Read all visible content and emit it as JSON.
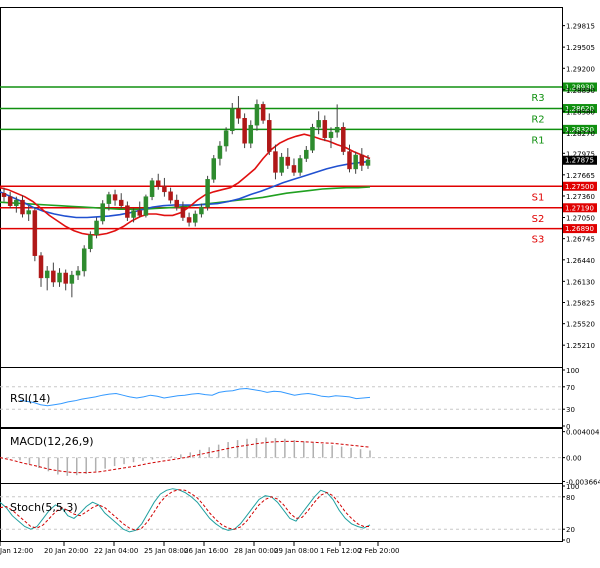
{
  "colors": {
    "background": "#ffffff",
    "axis": "#000000",
    "grid": "#c8c8c8",
    "bull_candle": "#2e8b2e",
    "bear_candle": "#b01818",
    "wick": "#404040",
    "ma_fast": "#e01010",
    "ma_mid": "#2050d0",
    "ma_slow": "#20a020",
    "resistance": "#109010",
    "support": "#e00000",
    "price_tag": "#000000",
    "rsi_line": "#3399ff",
    "macd_hist": "#b0b0b0",
    "macd_signal": "#d00000",
    "stoch_main": "#20a0a0",
    "stoch_signal": "#d00000"
  },
  "chart_data": [
    {
      "panel": "price",
      "type": "candlestick",
      "x": [
        "",
        "20 Jan 20:00",
        "22 Jan 04:00",
        "25 Jan 08:00",
        "26 Jan 16:00",
        "28 Jan 00:00",
        "29 Jan 08:00",
        "1 Feb 12:00",
        "2 Feb 20:00"
      ],
      "x_first_label_partial": "Jan 12:00",
      "y_ticks": [
        "1.29815",
        "1.29505",
        "1.29200",
        "1.28890",
        "1.28580",
        "1.28270",
        "1.27975",
        "1.27665",
        "1.27360",
        "1.27050",
        "1.26745",
        "1.26440",
        "1.26130",
        "1.25825",
        "1.25520",
        "1.25210"
      ],
      "ylim": [
        1.2491,
        1.3004
      ],
      "current_price": "1.27875",
      "levels": [
        {
          "label": "R3",
          "value": 1.2893,
          "tag": "1.28930",
          "kind": "resistance"
        },
        {
          "label": "R2",
          "value": 1.2862,
          "tag": "1.28620",
          "kind": "resistance"
        },
        {
          "label": "R1",
          "value": 1.2832,
          "tag": "1.28320",
          "kind": "resistance"
        },
        {
          "label": "S1",
          "value": 1.275,
          "tag": "1.27500",
          "kind": "support"
        },
        {
          "label": "S2",
          "value": 1.2719,
          "tag": "1.27190",
          "kind": "support"
        },
        {
          "label": "S3",
          "value": 1.2689,
          "tag": "1.26890",
          "kind": "support"
        }
      ],
      "candles": [
        [
          1.274,
          1.2748,
          1.2728,
          1.2735
        ],
        [
          1.2735,
          1.2742,
          1.2718,
          1.2722
        ],
        [
          1.2722,
          1.2735,
          1.2712,
          1.273
        ],
        [
          1.273,
          1.2737,
          1.2705,
          1.271
        ],
        [
          1.271,
          1.2722,
          1.27,
          1.2715
        ],
        [
          1.2715,
          1.272,
          1.2642,
          1.265
        ],
        [
          1.265,
          1.2655,
          1.2605,
          1.2618
        ],
        [
          1.2618,
          1.2635,
          1.26,
          1.2628
        ],
        [
          1.2628,
          1.264,
          1.2605,
          1.2612
        ],
        [
          1.2612,
          1.2632,
          1.2605,
          1.2625
        ],
        [
          1.2625,
          1.263,
          1.26,
          1.261
        ],
        [
          1.261,
          1.2628,
          1.259,
          1.2622
        ],
        [
          1.2622,
          1.2635,
          1.2615,
          1.2628
        ],
        [
          1.2628,
          1.2665,
          1.262,
          1.266
        ],
        [
          1.266,
          1.2685,
          1.2655,
          1.268
        ],
        [
          1.268,
          1.2705,
          1.2675,
          1.27
        ],
        [
          1.27,
          1.273,
          1.2695,
          1.2725
        ],
        [
          1.2725,
          1.2742,
          1.2715,
          1.2738
        ],
        [
          1.2738,
          1.2745,
          1.2722,
          1.273
        ],
        [
          1.273,
          1.274,
          1.2718,
          1.2722
        ],
        [
          1.2722,
          1.2728,
          1.27,
          1.2705
        ],
        [
          1.2705,
          1.2718,
          1.2698,
          1.2715
        ],
        [
          1.2715,
          1.2728,
          1.2705,
          1.2708
        ],
        [
          1.2708,
          1.2738,
          1.2705,
          1.2735
        ],
        [
          1.2735,
          1.2762,
          1.273,
          1.2758
        ],
        [
          1.2758,
          1.2768,
          1.2745,
          1.275
        ],
        [
          1.275,
          1.2762,
          1.2735,
          1.2742
        ],
        [
          1.2742,
          1.2748,
          1.2725,
          1.273
        ],
        [
          1.273,
          1.2738,
          1.2715,
          1.272
        ],
        [
          1.272,
          1.2728,
          1.27,
          1.2705
        ],
        [
          1.2705,
          1.2712,
          1.2692,
          1.2698
        ],
        [
          1.2698,
          1.2715,
          1.2692,
          1.271
        ],
        [
          1.271,
          1.2725,
          1.2705,
          1.272
        ],
        [
          1.272,
          1.2765,
          1.2715,
          1.276
        ],
        [
          1.276,
          1.2795,
          1.2755,
          1.279
        ],
        [
          1.279,
          1.2815,
          1.278,
          1.2808
        ],
        [
          1.2808,
          1.2835,
          1.28,
          1.283
        ],
        [
          1.283,
          1.287,
          1.2825,
          1.2862
        ],
        [
          1.2862,
          1.288,
          1.284,
          1.2848
        ],
        [
          1.2848,
          1.2855,
          1.2805,
          1.2812
        ],
        [
          1.2812,
          1.2845,
          1.2805,
          1.2838
        ],
        [
          1.2838,
          1.2875,
          1.283,
          1.2868
        ],
        [
          1.2868,
          1.2872,
          1.284,
          1.2845
        ],
        [
          1.2845,
          1.2855,
          1.2795,
          1.28
        ],
        [
          1.28,
          1.281,
          1.276,
          1.277
        ],
        [
          1.277,
          1.2798,
          1.2765,
          1.2792
        ],
        [
          1.2792,
          1.2805,
          1.2775,
          1.278
        ],
        [
          1.278,
          1.279,
          1.2765,
          1.277
        ],
        [
          1.277,
          1.2795,
          1.2765,
          1.279
        ],
        [
          1.279,
          1.2808,
          1.2785,
          1.2802
        ],
        [
          1.2802,
          1.284,
          1.2798,
          1.2835
        ],
        [
          1.2835,
          1.2858,
          1.2825,
          1.2845
        ],
        [
          1.2845,
          1.2852,
          1.2815,
          1.282
        ],
        [
          1.282,
          1.2835,
          1.2805,
          1.2828
        ],
        [
          1.2828,
          1.2868,
          1.282,
          1.2835
        ],
        [
          1.2835,
          1.2842,
          1.2795,
          1.28
        ],
        [
          1.28,
          1.281,
          1.277,
          1.2775
        ],
        [
          1.2775,
          1.28,
          1.2768,
          1.2795
        ],
        [
          1.2795,
          1.2805,
          1.2772,
          1.278
        ],
        [
          1.278,
          1.2795,
          1.2775,
          1.2788
        ]
      ],
      "ma_fast": [
        1.2748,
        1.2745,
        1.274,
        1.2735,
        1.2728,
        1.2718,
        1.2708,
        1.27,
        1.2692,
        1.2686,
        1.2682,
        1.268,
        1.268,
        1.2682,
        1.2686,
        1.2692,
        1.27,
        1.2706,
        1.271,
        1.271,
        1.2708,
        1.2708,
        1.2712,
        1.272,
        1.273,
        1.2738,
        1.2742,
        1.2745,
        1.2748,
        1.2755,
        1.2765,
        1.2775,
        1.279,
        1.2803,
        1.2812,
        1.2818,
        1.2822,
        1.2825,
        1.2822,
        1.2818,
        1.2815,
        1.281,
        1.2806,
        1.28,
        1.2795,
        1.279
      ],
      "ma_mid": [
        1.2742,
        1.2735,
        1.2728,
        1.272,
        1.2714,
        1.271,
        1.2707,
        1.2705,
        1.2705,
        1.2706,
        1.2707,
        1.2709,
        1.2712,
        1.2716,
        1.272,
        1.2722,
        1.2723,
        1.2723,
        1.2723,
        1.2724,
        1.2725,
        1.2728,
        1.2732,
        1.2738,
        1.2743,
        1.2749,
        1.2755,
        1.276,
        1.2765,
        1.277,
        1.2775,
        1.2779,
        1.2782,
        1.2784,
        1.2786
      ],
      "ma_slow": [
        1.2727,
        1.2726,
        1.2725,
        1.2724,
        1.2723,
        1.2722,
        1.2721,
        1.272,
        1.2719,
        1.2718,
        1.2717,
        1.2717,
        1.2717,
        1.2718,
        1.2719,
        1.272,
        1.2722,
        1.2724,
        1.2726,
        1.2728,
        1.273,
        1.2732,
        1.2734,
        1.2737,
        1.274,
        1.2742,
        1.2744,
        1.2746,
        1.2747,
        1.2748,
        1.2748,
        1.2749
      ]
    },
    {
      "panel": "rsi",
      "type": "line",
      "title": "RSI(14)",
      "y_ticks": [
        "100",
        "70",
        "30",
        "0"
      ],
      "ylim": [
        0,
        100
      ],
      "values": [
        46,
        44,
        42,
        38,
        36,
        38,
        40,
        43,
        45,
        48,
        50,
        52,
        55,
        57,
        58,
        55,
        52,
        50,
        52,
        55,
        53,
        50,
        52,
        54,
        55,
        57,
        58,
        56,
        55,
        60,
        62,
        63,
        66,
        67,
        65,
        63,
        60,
        62,
        61,
        58,
        55,
        57,
        58,
        56,
        53,
        52,
        54,
        53,
        52,
        49,
        50,
        51
      ]
    },
    {
      "panel": "macd",
      "type": "line",
      "title": "MACD(12,26,9)",
      "y_ticks": [
        "0.004004",
        "0.00",
        "-0.003664"
      ],
      "ylim": [
        -0.00375,
        0.0041
      ],
      "histogram": [
        -0.0004,
        -0.001,
        -0.0016,
        -0.0021,
        -0.0026,
        -0.0028,
        -0.0027,
        -0.0025,
        -0.0021,
        -0.0017,
        -0.0013,
        -0.001,
        -0.0007,
        -0.0005,
        -0.0003,
        -0.0001,
        0.0002,
        0.0005,
        0.0008,
        0.0012,
        0.0016,
        0.002,
        0.0024,
        0.0027,
        0.0029,
        0.003,
        0.0031,
        0.003,
        0.0029,
        0.0027,
        0.0025,
        0.0023,
        0.0021,
        0.0019,
        0.0017,
        0.0015,
        0.0013,
        0.0011
      ],
      "signal": [
        0.0,
        -0.0004,
        -0.0009,
        -0.0013,
        -0.0018,
        -0.0021,
        -0.0023,
        -0.0023,
        -0.0022,
        -0.0019,
        -0.0016,
        -0.0013,
        -0.0009,
        -0.0006,
        -0.0003,
        0.0,
        0.0004,
        0.0008,
        0.0012,
        0.0016,
        0.0019,
        0.0022,
        0.0024,
        0.0025,
        0.0025,
        0.0024,
        0.0023,
        0.0022,
        0.002,
        0.0018,
        0.0016
      ]
    },
    {
      "panel": "stochastic",
      "type": "line",
      "title": "Stoch(5,5,3)",
      "y_ticks": [
        "100",
        "80",
        "20",
        "0"
      ],
      "ylim": [
        0,
        100
      ],
      "main": [
        70,
        60,
        45,
        35,
        25,
        20,
        25,
        40,
        55,
        65,
        60,
        45,
        40,
        50,
        62,
        70,
        65,
        50,
        40,
        30,
        20,
        15,
        18,
        30,
        50,
        70,
        85,
        92,
        95,
        93,
        88,
        80,
        70,
        55,
        40,
        30,
        22,
        18,
        20,
        30,
        45,
        60,
        75,
        82,
        80,
        70,
        55,
        40,
        35,
        50,
        65,
        80,
        92,
        88,
        75,
        55,
        40,
        30,
        25,
        22,
        28
      ],
      "signal": [
        60,
        62,
        55,
        45,
        35,
        25,
        22,
        28,
        40,
        52,
        60,
        55,
        48,
        45,
        52,
        60,
        65,
        60,
        50,
        40,
        30,
        22,
        18,
        22,
        35,
        52,
        70,
        82,
        90,
        93,
        92,
        86,
        78,
        65,
        50,
        38,
        28,
        22,
        20,
        24,
        35,
        50,
        65,
        75,
        80,
        76,
        65,
        50,
        40,
        42,
        55,
        70,
        83,
        88,
        82,
        68,
        52,
        40,
        30,
        25,
        25
      ]
    }
  ]
}
